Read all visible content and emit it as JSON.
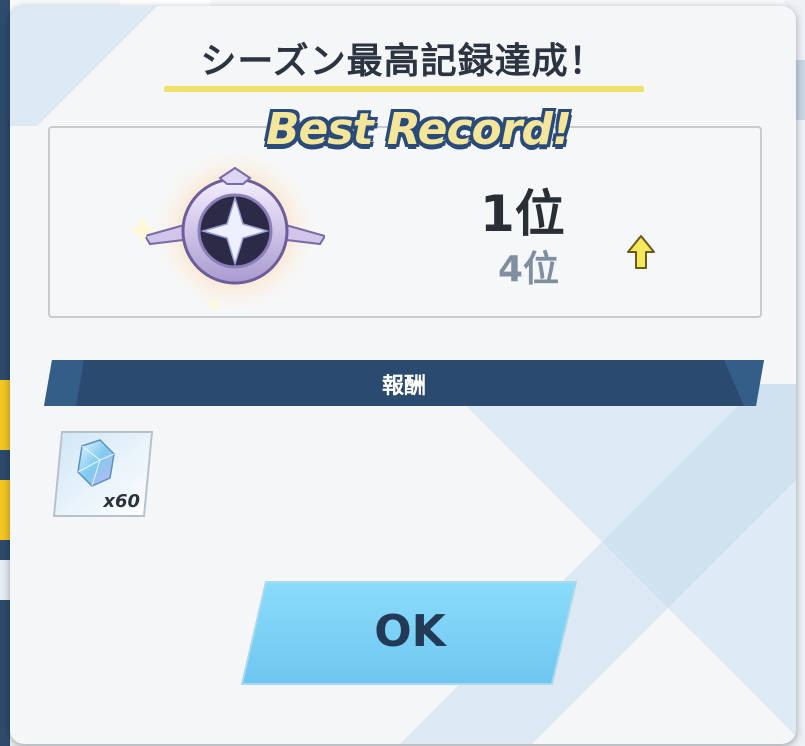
{
  "dialog": {
    "title": "シーズン最高記録達成！",
    "badge_text": "Best Record!"
  },
  "record": {
    "current_rank": "1位",
    "previous_rank": "4位",
    "change_icon": "up-arrow-icon"
  },
  "rewards": {
    "header": "報酬",
    "items": [
      {
        "icon": "crystal-icon",
        "count": "x60"
      }
    ]
  },
  "buttons": {
    "ok_label": "OK"
  },
  "colors": {
    "title_underline": "#f1e16a",
    "reward_bar": "#2b4a70",
    "ok_button": "#7fd3f6",
    "arrow": "#f6e85c"
  }
}
